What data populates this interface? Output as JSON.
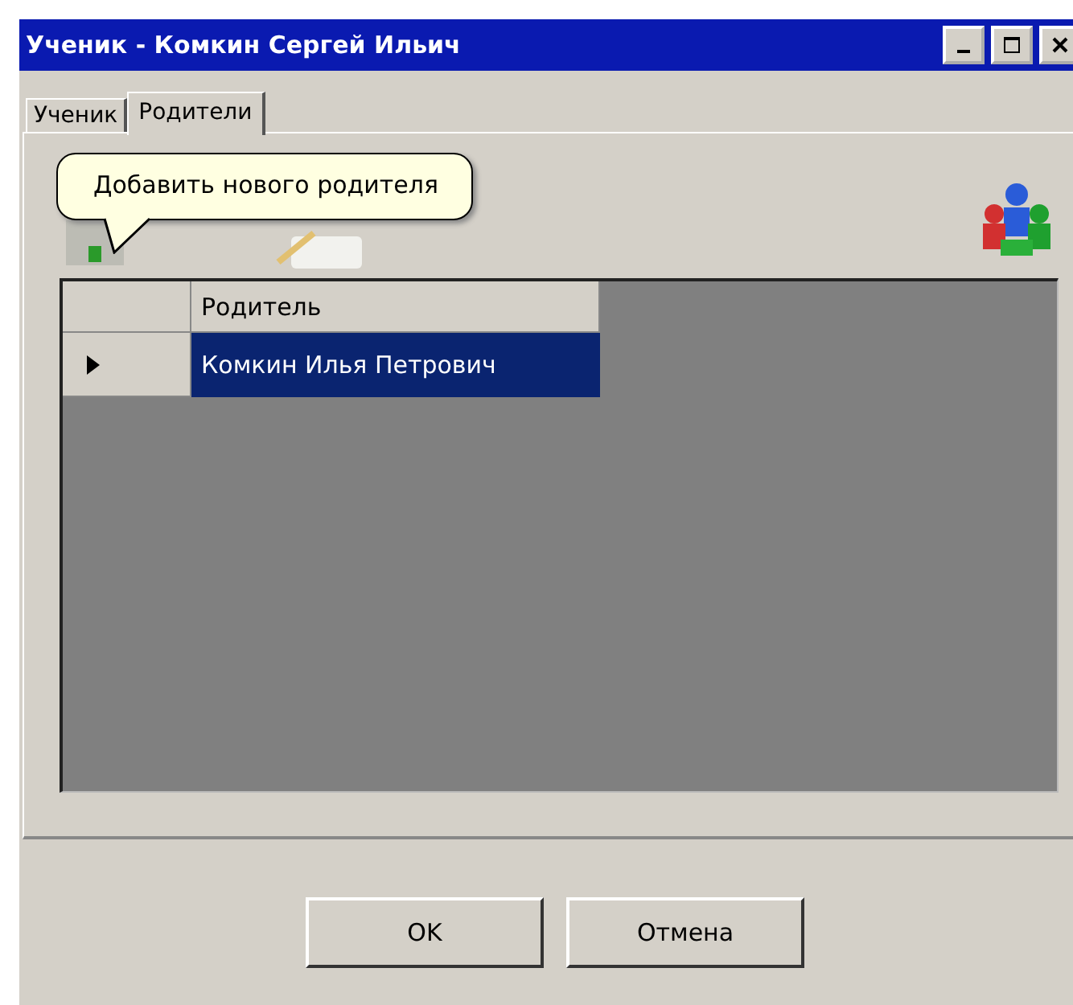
{
  "window": {
    "title": "Ученик - Комкин Сергей Ильич"
  },
  "tabs": [
    {
      "label": "Ученик",
      "selected": false
    },
    {
      "label": "Родители",
      "selected": true
    }
  ],
  "tooltip": {
    "text": "Добавить нового родителя"
  },
  "grid": {
    "columns": [
      "Родитель"
    ],
    "rows": [
      {
        "cells": [
          "Комкин Илья Петрович"
        ],
        "selected": true,
        "current": true
      }
    ]
  },
  "buttons": [
    "OK",
    "Отмена"
  ]
}
